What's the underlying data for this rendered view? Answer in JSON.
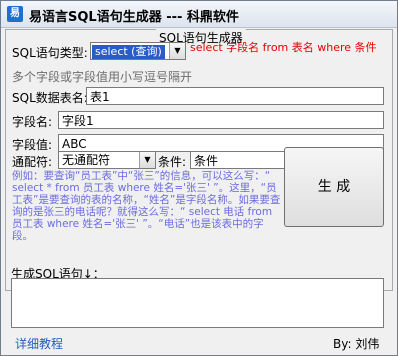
{
  "window": {
    "title": "易语言SQL语句生成器 --- 科鼎软件"
  },
  "group": {
    "legend": "SQL语句生成器"
  },
  "form": {
    "type_label": "SQL语句类型:",
    "type_value": "select (查询)",
    "type_hint": "select 字段名 from 表名 where 条件",
    "multi_hint": "多个字段或字段值用小写逗号隔开",
    "table_label": "SQL数据表名:",
    "table_value": "表1",
    "field_label": "字段名:",
    "field_value": "字段1",
    "value_label": "字段值:",
    "value_value": "ABC",
    "wildcard_label": "通配符:",
    "wildcard_value": "无通配符",
    "condition_label": "条件:",
    "condition_value": "条件"
  },
  "example_text": "例如：要查询“员工表”中“张三”的信息，可以这么写：“ select * from 员工表 where 姓名='张三' ”。这里，“员工表”是要查询的表的名称，“姓名”是字段名称。如果要查询的是张三的电话呢？就得这么写：“ select 电话 from 员工表 where 姓名='张三' ”。“电话”也是该表中的字段。",
  "generate_button": "生 成",
  "output_label": "生成SQL语句↓：",
  "output_value": "",
  "footer": {
    "link": "详细教程",
    "author": "By: 刘伟"
  },
  "colors": {
    "hint_red": "#e60000",
    "example_blue": "#6b6be0",
    "link_blue": "#1f5bbf"
  }
}
